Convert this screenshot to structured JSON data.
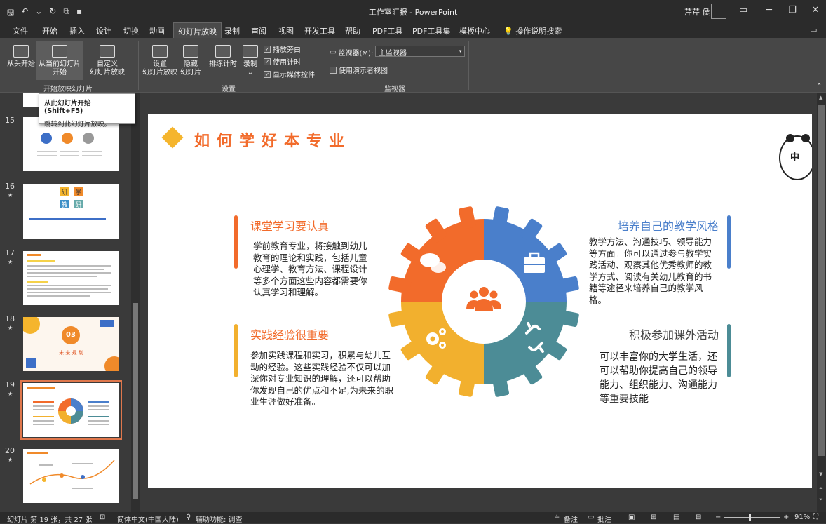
{
  "window": {
    "title": "工作室汇报 - PowerPoint",
    "user": "芹芹 侯",
    "quick_access": [
      "🖫",
      "↶",
      "⌄",
      "↻",
      "⧉",
      "▪"
    ]
  },
  "tabs": [
    "文件",
    "开始",
    "插入",
    "设计",
    "切换",
    "动画",
    "幻灯片放映",
    "录制",
    "审阅",
    "视图",
    "开发工具",
    "帮助",
    "PDF工具",
    "PDF工具集",
    "模板中心",
    "操作说明搜索"
  ],
  "active_tab": "幻灯片放映",
  "ribbon": {
    "from_start": "从头开始",
    "from_current_l1": "从当前幻灯片",
    "from_current_l2": "开始",
    "custom_l1": "自定义",
    "custom_l2": "幻灯片放映",
    "group_start": "开始放映幻灯片",
    "setup_l1": "设置",
    "setup_l2": "幻灯片放映",
    "hide_l1": "隐藏",
    "hide_l2": "幻灯片",
    "rehearse": "排练计时",
    "record": "录制",
    "play_narration": "播放旁白",
    "use_timings": "使用计时",
    "show_media": "显示媒体控件",
    "group_setup": "设置",
    "monitor_label": "监视器(M):",
    "monitor_value": "主监视器",
    "presenter_view": "使用演示者视图",
    "group_monitor": "监视器"
  },
  "tooltip": {
    "title": "从此幻灯片开始 (Shift+F5)",
    "desc": "跳转到此幻灯片放映。"
  },
  "thumbnails": [
    {
      "num": "15",
      "star": ""
    },
    {
      "num": "16",
      "star": "★"
    },
    {
      "num": "17",
      "star": "★"
    },
    {
      "num": "18",
      "star": "★"
    },
    {
      "num": "19",
      "star": "★"
    },
    {
      "num": "20",
      "star": "★"
    }
  ],
  "thumb16": {
    "c1": "研",
    "c2": "学",
    "c3": "教",
    "c4": "研"
  },
  "thumb18": {
    "num": "03",
    "text": "未 来 规 划"
  },
  "slide": {
    "title": "如何学好本专业",
    "sticker": "中",
    "s1_head": "课堂学习要认真",
    "s1_body": "学前教育专业，将接触到幼儿教育的理论和实践，包括儿童心理学、教育方法、课程设计等多个方面这些内容都需要你认真学习和理解。",
    "s2_head": "实践经验很重要",
    "s2_body": "参加实践课程和实习，积累与幼儿互动的经验。这些实践经验不仅可以加深你对专业知识的理解，还可以帮助你发现自己的优点和不足,为未来的职业生涯做好准备。",
    "s3_head": "培养自己的教学风格",
    "s3_body": "教学方法、沟通技巧、领导能力等方面。你可以通过参与教学实践活动、观察其他优秀教师的教学方式、阅读有关幼儿教育的书籍等途径来培养自己的教学风格。",
    "s4_head": "积极参加课外活动",
    "s4_body": "可以丰富你的大学生活，还可以帮助你提高自己的领导能力、组织能力、沟通能力等重要技能"
  },
  "colors": {
    "orange": "#f26b2b",
    "blue": "#4a7fcb",
    "yellow": "#f2b02e",
    "teal": "#4c8c96"
  },
  "status": {
    "slide_info": "幻灯片 第 19 张，共 27 张",
    "language": "简体中文(中国大陆)",
    "accessibility": "辅助功能: 调查",
    "notes": "备注",
    "comments": "批注",
    "zoom": "91%"
  }
}
